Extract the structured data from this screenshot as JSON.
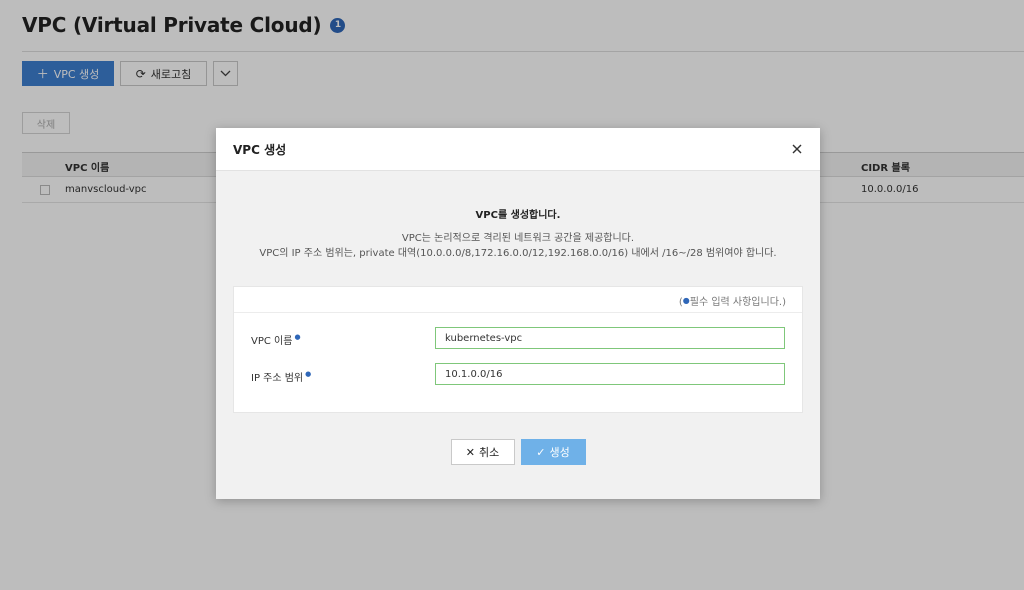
{
  "page": {
    "title": "VPC (Virtual Private Cloud)",
    "help_badge": "1"
  },
  "toolbar": {
    "create_label": "VPC 생성",
    "refresh_label": "새로고침",
    "delete_label": "삭제"
  },
  "table": {
    "columns": [
      "VPC 이름",
      "CIDR 블록"
    ],
    "rows": [
      {
        "name": "manvscloud-vpc",
        "cidr": "10.0.0.0/16"
      }
    ]
  },
  "modal": {
    "title": "VPC 생성",
    "intro_title": "VPC를 생성합니다.",
    "intro_line1": "VPC는 논리적으로 격리된 네트워크 공간을 제공합니다.",
    "intro_line2": "VPC의 IP 주소 범위는, private 대역(10.0.0.0/8,172.16.0.0/12,192.168.0.0/16) 내에서 /16~/28 범위여야 합니다.",
    "required_note_open": "(",
    "required_note_text": "필수 입력 사항입니다.)",
    "fields": {
      "vpc_name_label": "VPC 이름",
      "vpc_name_value": "kubernetes-vpc",
      "ip_range_label": "IP 주소 범위",
      "ip_range_value": "10.1.0.0/16"
    },
    "cancel_label": "취소",
    "create_label": "생성"
  },
  "colors": {
    "primary": "#3d7fd0",
    "create_button": "#6fb1e8",
    "required_dot": "#2f67b8",
    "input_border": "#7fc77a"
  }
}
